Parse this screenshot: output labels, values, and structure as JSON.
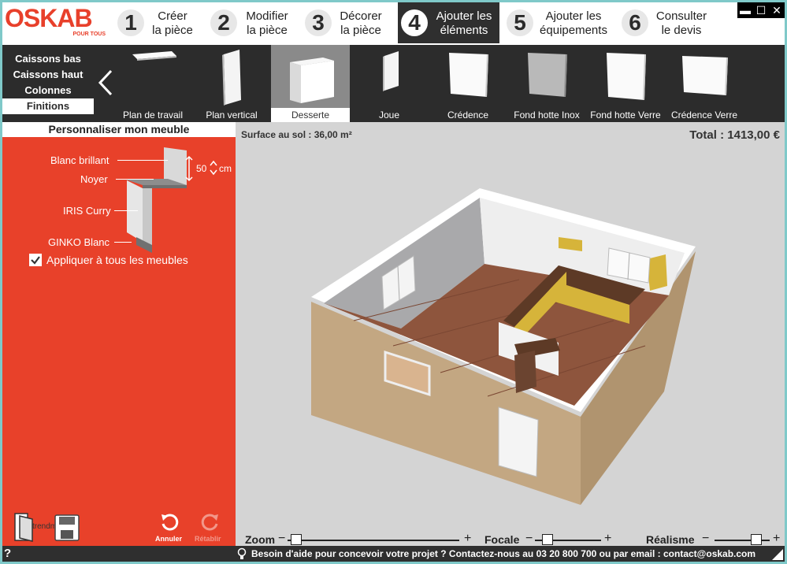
{
  "brand": {
    "logo": "OSKAB",
    "tagline": "POUR TOUS",
    "accent": "#e8402b"
  },
  "steps": [
    {
      "num": "1",
      "line1": "Créer",
      "line2": "la pièce"
    },
    {
      "num": "2",
      "line1": "Modifier",
      "line2": "la pièce"
    },
    {
      "num": "3",
      "line1": "Décorer",
      "line2": "la pièce"
    },
    {
      "num": "4",
      "line1": "Ajouter les",
      "line2": "éléments",
      "active": true
    },
    {
      "num": "5",
      "line1": "Ajouter les",
      "line2": "équipements"
    },
    {
      "num": "6",
      "line1": "Consulter",
      "line2": "le devis"
    }
  ],
  "window_controls": {
    "minimize": "▬",
    "maximize": "☐",
    "close": "✕"
  },
  "categories": [
    "Caissons bas",
    "Caissons haut",
    "Colonnes",
    "Finitions"
  ],
  "selected_category": "Finitions",
  "items": [
    "Plan de travail",
    "Plan vertical",
    "Desserte",
    "Joue",
    "Crédence",
    "Fond hotte Inox",
    "Fond hotte Verre",
    "Crédence Verre"
  ],
  "selected_item": "Desserte",
  "panel": {
    "title": "Personnaliser mon meuble",
    "finishes": [
      "Blanc brillant",
      "Noyer",
      "IRIS Curry",
      "GINKO Blanc"
    ],
    "height_value": "50",
    "height_unit": "cm",
    "apply_all": "Appliquer à tous les meubles",
    "apply_all_checked": true,
    "tools": {
      "save_label": "trendmx.com",
      "undo": "Annuler",
      "redo": "Rétablir"
    }
  },
  "view": {
    "surface": "Surface au sol : 36,00 m²",
    "total": "Total : 1413,00 €",
    "sliders": [
      {
        "label": "Zoom",
        "value": 0.02
      },
      {
        "label": "Focale",
        "value": 0.13
      },
      {
        "label": "Réalisme",
        "value": 0.8
      }
    ],
    "minus": "−",
    "plus": "+"
  },
  "status": {
    "help": "?",
    "message": "Besoin d'aide pour concevoir votre projet ? Contactez-nous au 03 20 800 700 ou par email : contact@oskab.com"
  }
}
